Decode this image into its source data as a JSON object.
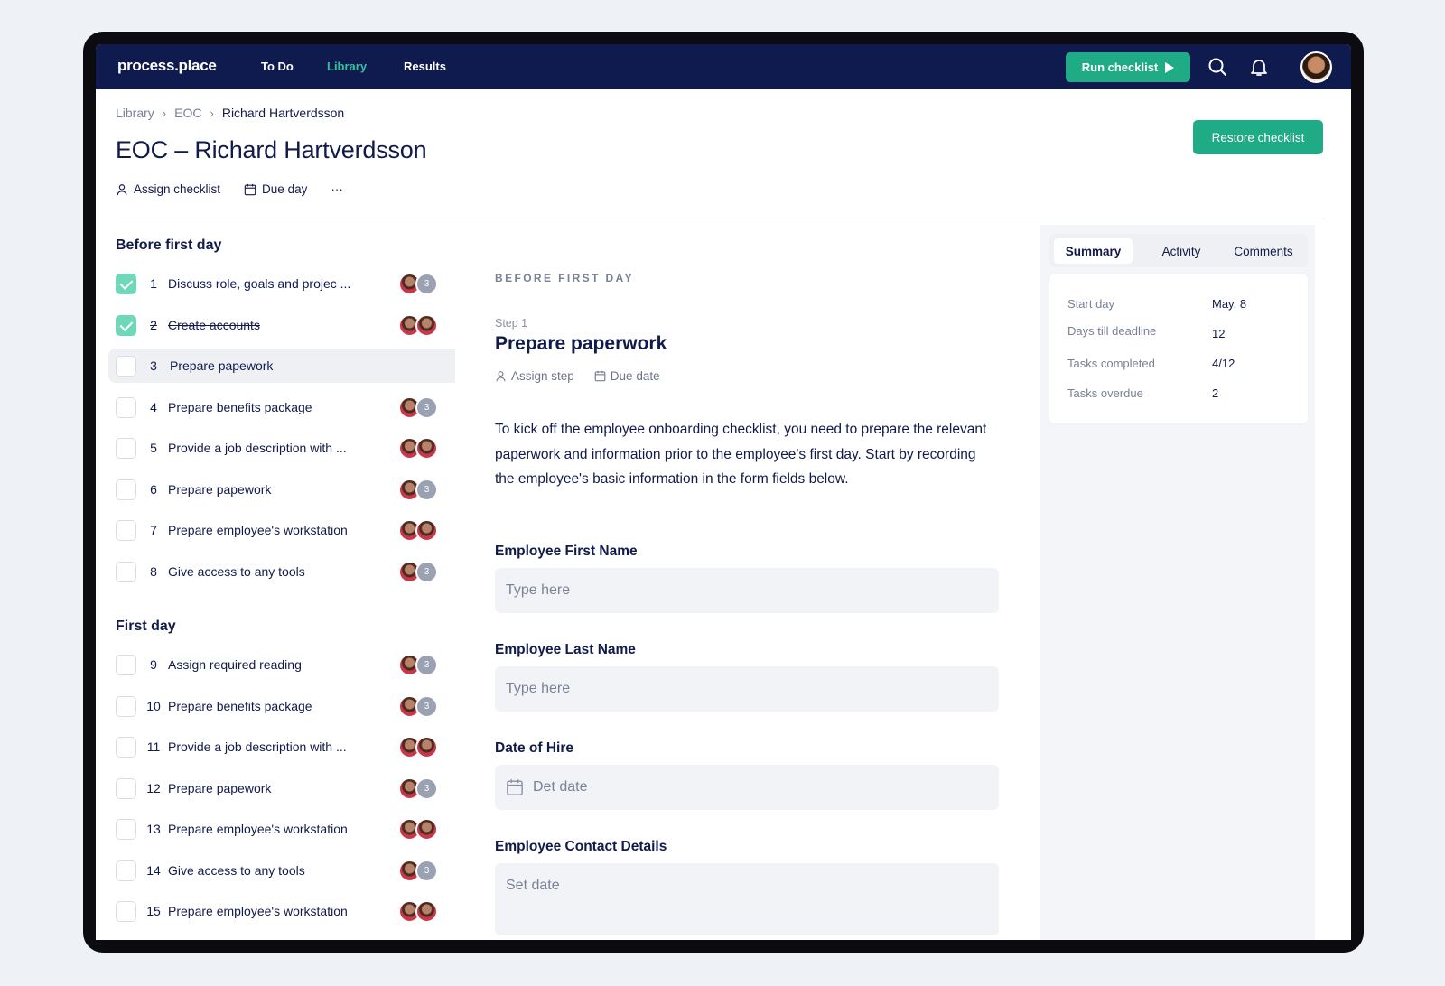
{
  "nav": {
    "logo": "process.place",
    "links": [
      "To Do",
      "Library",
      "Results"
    ],
    "run_button": "Run checklist",
    "icons": [
      "search-icon",
      "bell-icon"
    ]
  },
  "colors": {
    "nav_bg": "#0f1a4f",
    "accent": "#1eab85",
    "active_link": "#2fc3a0"
  },
  "breadcrumb": [
    "Library",
    "EOC",
    "Richard Hartverdsson"
  ],
  "page": {
    "title": "EOC – Richard Hartverdsson",
    "restore_button": "Restore checklist",
    "assign": "Assign checklist",
    "due": "Due day",
    "more": "···"
  },
  "sections": [
    {
      "title": "Before first day",
      "tasks": [
        {
          "num": "1",
          "label": "Discuss role, goals and projec ...",
          "done": true,
          "avatars": "one-plus",
          "more": "3"
        },
        {
          "num": "2",
          "label": "Create accounts",
          "done": true,
          "avatars": "two",
          "more": ""
        },
        {
          "num": "3",
          "label": "Prepare papework",
          "done": false,
          "active": true,
          "avatars": "none",
          "more": ""
        },
        {
          "num": "4",
          "label": "Prepare benefits package",
          "done": false,
          "avatars": "one-plus",
          "more": "3"
        },
        {
          "num": "5",
          "label": "Provide a job description with ...",
          "done": false,
          "avatars": "two",
          "more": ""
        },
        {
          "num": "6",
          "label": "Prepare papework",
          "done": false,
          "avatars": "one-plus",
          "more": "3"
        },
        {
          "num": "7",
          "label": "Prepare employee's workstation",
          "done": false,
          "avatars": "two",
          "more": ""
        },
        {
          "num": "8",
          "label": "Give access to any tools",
          "done": false,
          "avatars": "one-plus",
          "more": "3"
        }
      ]
    },
    {
      "title": "First day",
      "tasks": [
        {
          "num": "9",
          "label": "Assign required reading",
          "done": false,
          "avatars": "one-plus",
          "more": "3"
        },
        {
          "num": "10",
          "label": "Prepare benefits package",
          "done": false,
          "avatars": "one-plus",
          "more": "3"
        },
        {
          "num": "11",
          "label": "Provide a job description with ...",
          "done": false,
          "avatars": "two",
          "more": ""
        },
        {
          "num": "12",
          "label": "Prepare papework",
          "done": false,
          "avatars": "one-plus",
          "more": "3"
        },
        {
          "num": "13",
          "label": "Prepare employee's workstation",
          "done": false,
          "avatars": "two",
          "more": ""
        },
        {
          "num": "14",
          "label": "Give access to any tools",
          "done": false,
          "avatars": "one-plus",
          "more": "3"
        },
        {
          "num": "15",
          "label": "Prepare employee's workstation",
          "done": false,
          "avatars": "two",
          "more": ""
        }
      ]
    }
  ],
  "step": {
    "section": "BEFORE FIRST DAY",
    "step_label": "Step 1",
    "title": "Prepare paperwork",
    "assign": "Assign step",
    "due": "Due date",
    "description": "To kick off the employee onboarding checklist, you need to prepare the relevant paperwork and information prior to the employee's first day. Start by recording the employee's basic information in the form fields below.",
    "fields": [
      {
        "label": "Employee First Name",
        "placeholder": "Type here",
        "icon": ""
      },
      {
        "label": "Employee Last Name",
        "placeholder": "Type here",
        "icon": ""
      },
      {
        "label": "Date of Hire",
        "placeholder": "Det date",
        "icon": "calendar-icon"
      },
      {
        "label": "Employee Contact Details",
        "placeholder": "Set date",
        "icon": ""
      }
    ]
  },
  "side_tabs": [
    "Summary",
    "Activity",
    "Comments"
  ],
  "summary": [
    {
      "label": "Start day",
      "value": "May, 8"
    },
    {
      "label": "Days till deadline",
      "value": "12"
    },
    {
      "label": "Tasks completed",
      "value": "4/12"
    },
    {
      "label": "Tasks overdue",
      "value": "2"
    }
  ]
}
